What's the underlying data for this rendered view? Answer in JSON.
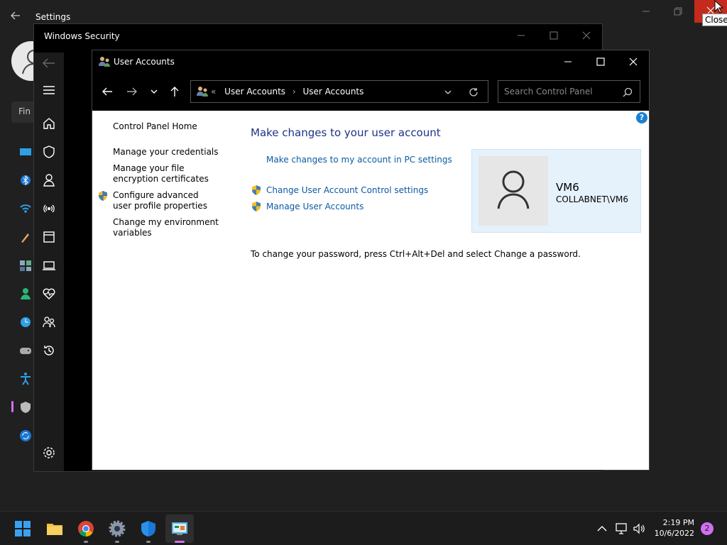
{
  "settings": {
    "title": "Settings",
    "search_partial": "Fin",
    "close_tooltip": "Close"
  },
  "windows_security": {
    "title": "Windows Security"
  },
  "user_accounts": {
    "title": "User Accounts",
    "breadcrumb": [
      "User Accounts",
      "User Accounts"
    ],
    "breadcrumb_overflow": "«",
    "search_placeholder": "Search Control Panel",
    "help_label": "?",
    "left_nav": [
      "Control Panel Home",
      "Manage your credentials",
      "Manage your file encryption certificates",
      "Configure advanced user profile properties",
      "Change my environment variables"
    ],
    "heading": "Make changes to your user account",
    "links": {
      "pc_settings": "Make changes to my account in PC settings",
      "uac": "Change User Account Control settings",
      "manage_accounts": "Manage User Accounts"
    },
    "user": {
      "name": "VM6",
      "domain": "COLLABNET\\VM6"
    },
    "password_note": "To change your password, press Ctrl+Alt+Del and select Change a password."
  },
  "taskbar": {
    "apps": [
      "start-icon",
      "file-explorer-icon",
      "chrome-icon",
      "settings-icon",
      "windows-security-icon",
      "control-panel-icon"
    ],
    "time": "2:19 PM",
    "date": "10/6/2022",
    "notification_count": "2"
  },
  "colors": {
    "link": "#0b5aa2",
    "heading": "#1e3287",
    "close_red": "#c42b1c",
    "accent_pink": "#d070f0",
    "user_card": "#e5f1fb"
  }
}
